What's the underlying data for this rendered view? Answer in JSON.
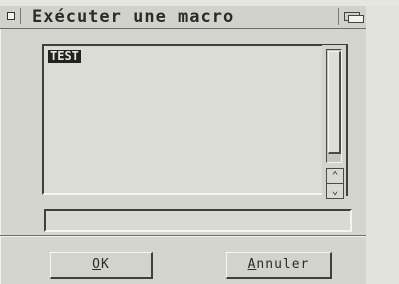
{
  "window": {
    "title": "Exécuter une macro",
    "close_icon": "close-gadget-icon",
    "depth_icon": "depth-gadget-icon"
  },
  "macro_list": {
    "items": [
      "TEST"
    ],
    "selected_index": 0
  },
  "scrollbar": {
    "up_icon": "scroll-up-arrow-icon",
    "down_icon": "scroll-down-arrow-icon"
  },
  "macro_name_input": {
    "value": ""
  },
  "buttons": {
    "ok": {
      "underlined_char": "O",
      "rest": "K"
    },
    "cancel": {
      "underlined_char": "A",
      "rest": "nnuler"
    }
  },
  "colors": {
    "background": "#d5d5cf",
    "selection_bg": "#222222",
    "selection_fg": "#e6e6e1",
    "shadow": "#3f3f3d",
    "highlight": "#f4f4f0"
  }
}
